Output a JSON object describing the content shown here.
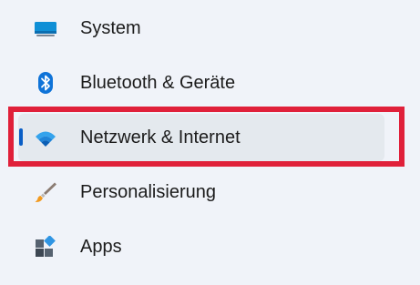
{
  "nav": {
    "items": [
      {
        "label": "System",
        "icon": "monitor-icon"
      },
      {
        "label": "Bluetooth & Geräte",
        "icon": "bluetooth-icon"
      },
      {
        "label": "Netzwerk & Internet",
        "icon": "wifi-icon"
      },
      {
        "label": "Personalisierung",
        "icon": "paintbrush-icon"
      },
      {
        "label": "Apps",
        "icon": "apps-icon"
      }
    ],
    "selected_index": 2
  },
  "colors": {
    "background": "#f0f3f9",
    "selected_background": "#e4e9ee",
    "accent": "#0a5fc6",
    "highlight_border": "#e0203a"
  }
}
